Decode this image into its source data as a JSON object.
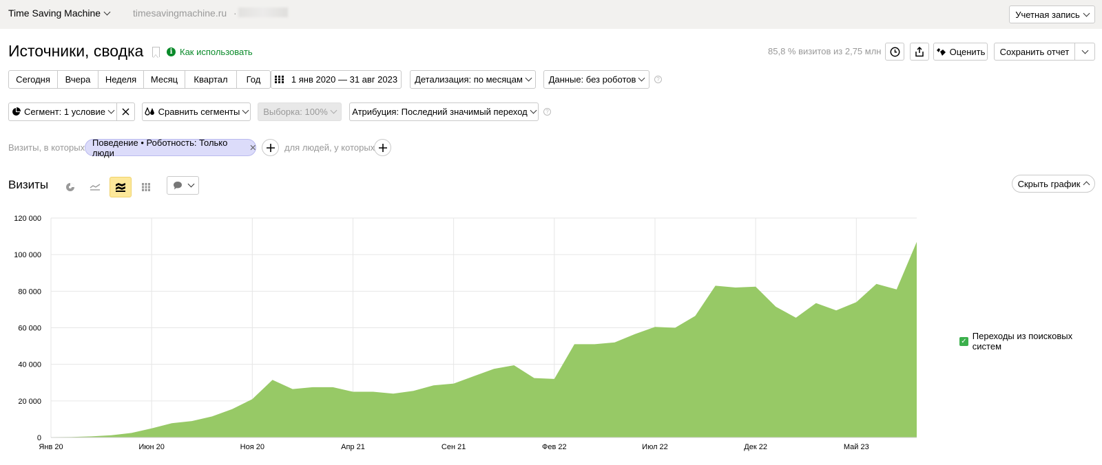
{
  "topbar": {
    "app_name": "Time Saving Machine",
    "site": "timesavingmachine.ru",
    "site_separator": "·",
    "account_label": "Учетная запись"
  },
  "header": {
    "title": "Источники, сводка",
    "help_link": "Как использовать",
    "visits_share": "85,8 % визитов из 2,75 млн",
    "rate_label": "Оценить",
    "save_label": "Сохранить отчет"
  },
  "period": {
    "presets": [
      "Сегодня",
      "Вчера",
      "Неделя",
      "Месяц",
      "Квартал",
      "Год"
    ],
    "date_range": "1 янв 2020 — 31 авг 2023",
    "detail": "Детализация: по месяцам",
    "data_filter": "Данные: без роботов"
  },
  "segment": {
    "segment_label": "Сегмент: 1 условие",
    "compare_label": "Сравнить сегменты",
    "sample_label": "Выборка: 100%",
    "attribution_label": "Атрибуция: Последний значимый переход"
  },
  "filters": {
    "visits_where": "Визиты, в которых",
    "chip": "Поведение • Роботность: Только люди",
    "people_where": "для людей, у которых"
  },
  "chart_panel": {
    "title": "Визиты",
    "hide_label": "Скрыть график",
    "legend": "Переходы из поисковых систем",
    "series_color": "#97c966",
    "check_color": "#3bb04c"
  },
  "chart_data": {
    "type": "area",
    "title": "Визиты",
    "xlabel": "",
    "ylabel": "",
    "ylim": [
      0,
      120000
    ],
    "yticks": [
      0,
      20000,
      40000,
      60000,
      80000,
      100000,
      120000
    ],
    "ytick_labels": [
      "0",
      "20 000",
      "40 000",
      "60 000",
      "80 000",
      "100 000",
      "120 000"
    ],
    "xtick_labels": [
      "Янв 20",
      "Июн 20",
      "Ноя 20",
      "Апр 21",
      "Сен 21",
      "Фев 22",
      "Июл 22",
      "Дек 22",
      "Май 23"
    ],
    "xtick_index": [
      0,
      5,
      10,
      15,
      20,
      25,
      30,
      35,
      40
    ],
    "grid": true,
    "legend_position": "right",
    "x": [
      "2020-01",
      "2020-02",
      "2020-03",
      "2020-04",
      "2020-05",
      "2020-06",
      "2020-07",
      "2020-08",
      "2020-09",
      "2020-10",
      "2020-11",
      "2020-12",
      "2021-01",
      "2021-02",
      "2021-03",
      "2021-04",
      "2021-05",
      "2021-06",
      "2021-07",
      "2021-08",
      "2021-09",
      "2021-10",
      "2021-11",
      "2021-12",
      "2022-01",
      "2022-02",
      "2022-03",
      "2022-04",
      "2022-05",
      "2022-06",
      "2022-07",
      "2022-08",
      "2022-09",
      "2022-10",
      "2022-11",
      "2022-12",
      "2023-01",
      "2023-02",
      "2023-03",
      "2023-04",
      "2023-05",
      "2023-06",
      "2023-07",
      "2023-08"
    ],
    "series": [
      {
        "name": "Переходы из поисковых систем",
        "values": [
          200,
          300,
          600,
          1200,
          2500,
          5000,
          7800,
          9000,
          11500,
          15500,
          21000,
          31500,
          26500,
          27500,
          27500,
          25000,
          25000,
          24000,
          25500,
          28500,
          29500,
          33500,
          37500,
          39500,
          32500,
          32000,
          51000,
          51000,
          52000,
          56500,
          60500,
          60000,
          66500,
          83000,
          82000,
          82500,
          71500,
          65500,
          73500,
          69500,
          74000,
          84000,
          81000,
          107000
        ]
      }
    ]
  }
}
